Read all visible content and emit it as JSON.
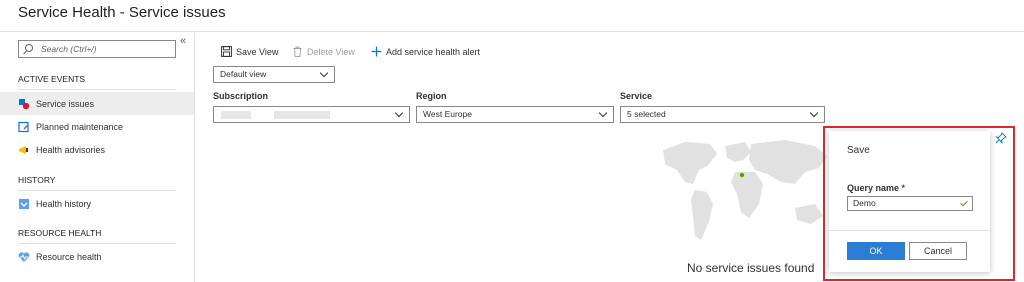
{
  "page": {
    "title": "Service Health - Service issues"
  },
  "sidebar": {
    "search_placeholder": "Search (Ctrl+/)",
    "collapse_glyph": "«",
    "sections": [
      {
        "title": "ACTIVE EVENTS",
        "items": [
          {
            "label": "Service issues",
            "icon": "service-issues-icon",
            "active": true
          },
          {
            "label": "Planned maintenance",
            "icon": "planned-maintenance-icon"
          },
          {
            "label": "Health advisories",
            "icon": "health-advisories-icon"
          }
        ]
      },
      {
        "title": "HISTORY",
        "items": [
          {
            "label": "Health history",
            "icon": "health-history-icon"
          }
        ]
      },
      {
        "title": "RESOURCE HEALTH",
        "items": [
          {
            "label": "Resource health",
            "icon": "resource-health-icon"
          }
        ]
      }
    ]
  },
  "toolbar": {
    "save_view": "Save View",
    "delete_view": "Delete View",
    "add_alert": "Add service health alert"
  },
  "view_select": {
    "value": "Default view"
  },
  "filters": {
    "subscription": {
      "label": "Subscription",
      "value": ""
    },
    "region": {
      "label": "Region",
      "value": "West Europe"
    },
    "service": {
      "label": "Service",
      "value": "5 selected"
    }
  },
  "main": {
    "empty_message": "No service issues found"
  },
  "dialog": {
    "title": "Save",
    "field_label": "Query name",
    "required_mark": "*",
    "field_value": "Demo",
    "ok": "OK",
    "cancel": "Cancel"
  },
  "colors": {
    "accent": "#2b7cd3",
    "highlight_frame": "#e0272f",
    "map_land": "#e1e1e1",
    "map_marker": "#57a300"
  }
}
